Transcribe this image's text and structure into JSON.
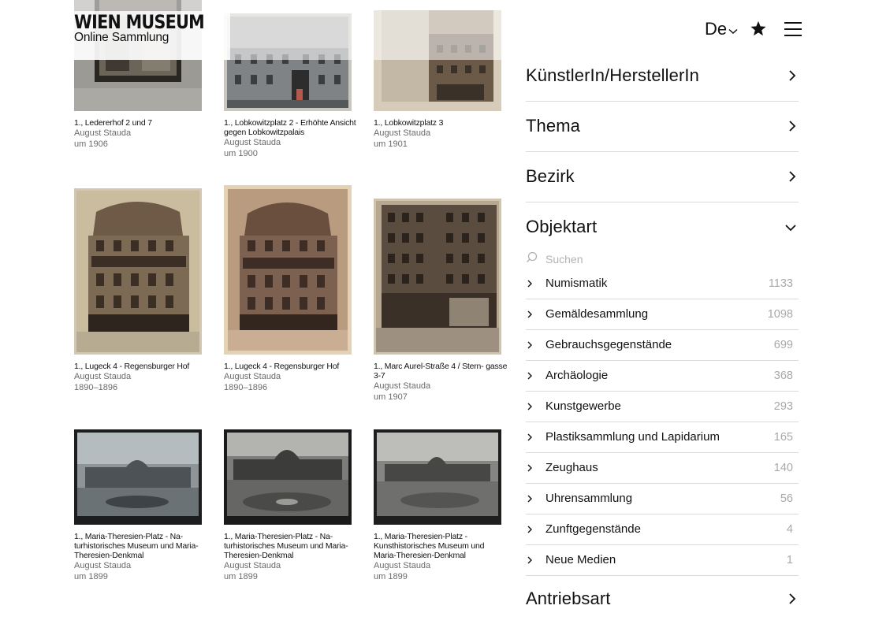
{
  "logo": {
    "main": "WIEN MUSEUM",
    "sub": "Online Sammlung"
  },
  "header": {
    "language": "De"
  },
  "icons": {
    "language": "chevron-down-icon",
    "favorites": "star-icon",
    "menu": "hamburger-menu-icon",
    "search": "search-icon",
    "facet_collapsed": "chevron-right-icon",
    "facet_expanded": "chevron-down-icon"
  },
  "gallery": [
    {
      "title": "1., Ledererhof 2 und 7",
      "author": "August Stauda",
      "date": "um 1906"
    },
    {
      "title": "1., Lobkowitzplatz 2 - Erhöhte Ansicht gegen Lobkowitzpalais",
      "author": "August Stauda",
      "date": "um 1900"
    },
    {
      "title": "1., Lobkowitzplatz 3",
      "author": "August Stauda",
      "date": "um 1901"
    },
    {
      "title": "1., Lugeck 4 - Regensburger Hof",
      "author": "August Stauda",
      "date": "1890–1896"
    },
    {
      "title": "1., Lugeck 4 - Regensburger Hof",
      "author": "August Stauda",
      "date": "1890–1896"
    },
    {
      "title": "1., Marc Aurel-Straße 4 / Stern- gasse 3-7",
      "author": "August Stauda",
      "date": "um 1907"
    },
    {
      "title": "1., Maria-Theresien-Platz - Na- turhistorisches Museum und Maria-Theresien-Denkmal",
      "author": "August Stauda",
      "date": "um 1899"
    },
    {
      "title": "1., Maria-Theresien-Platz - Na- turhistorisches Museum und Maria-Theresien-Denkmal",
      "author": "August Stauda",
      "date": "um 1899"
    },
    {
      "title": "1., Maria-Theresien-Platz - Kunsthistorisches Museum und Maria-Theresien-Denkmal",
      "author": "August Stauda",
      "date": "um 1899"
    }
  ],
  "filters": {
    "facets": [
      {
        "label": "KünstlerIn/HerstellerIn",
        "expanded": false
      },
      {
        "label": "Thema",
        "expanded": false
      },
      {
        "label": "Bezirk",
        "expanded": false
      },
      {
        "label": "Objektart",
        "expanded": true
      },
      {
        "label": "Antriebsart",
        "expanded": false
      }
    ],
    "search_placeholder": "Suchen",
    "objektart_options": [
      {
        "label": "Numismatik",
        "count": "1133"
      },
      {
        "label": "Gemäldesammlung",
        "count": "1098"
      },
      {
        "label": "Gebrauchsgegenstände",
        "count": "699"
      },
      {
        "label": "Archäologie",
        "count": "368"
      },
      {
        "label": "Kunstgewerbe",
        "count": "293"
      },
      {
        "label": "Plastiksammlung und Lapidarium",
        "count": "165"
      },
      {
        "label": "Zeughaus",
        "count": "140"
      },
      {
        "label": "Uhrensammlung",
        "count": "56"
      },
      {
        "label": "Zunftgegenstände",
        "count": "4"
      },
      {
        "label": "Neue Medien",
        "count": "1"
      }
    ]
  }
}
